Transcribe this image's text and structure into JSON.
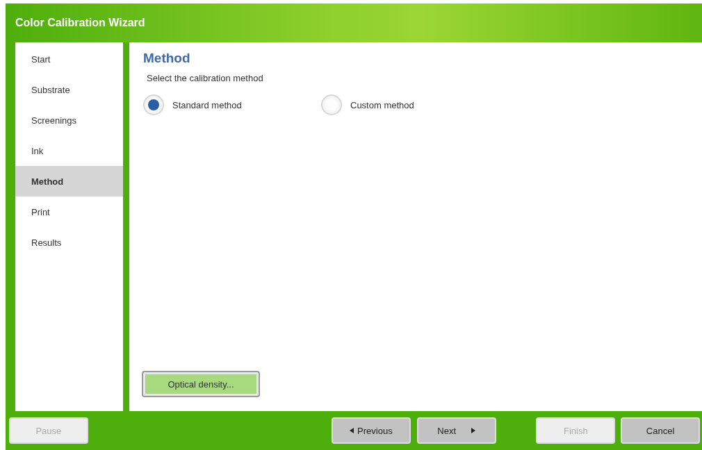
{
  "window": {
    "title": "Color Calibration Wizard"
  },
  "sidebar": {
    "items": [
      {
        "label": "Start",
        "selected": false
      },
      {
        "label": "Substrate",
        "selected": false
      },
      {
        "label": "Screenings",
        "selected": false
      },
      {
        "label": "Ink",
        "selected": false
      },
      {
        "label": "Method",
        "selected": true
      },
      {
        "label": "Print",
        "selected": false
      },
      {
        "label": "Results",
        "selected": false
      }
    ]
  },
  "content": {
    "heading": "Method",
    "instruction": "Select the calibration method",
    "options": [
      {
        "label": "Standard method",
        "selected": true
      },
      {
        "label": "Custom method",
        "selected": false
      }
    ],
    "action_button": "Optical density..."
  },
  "footer": {
    "buttons": [
      {
        "label": "Pause",
        "kind": "plain",
        "disabled": true
      },
      {
        "label": "Previous",
        "kind": "back",
        "disabled": false
      },
      {
        "label": "Next",
        "kind": "forward",
        "disabled": false
      },
      {
        "label": "Finish",
        "kind": "plain",
        "disabled": true
      },
      {
        "label": "Cancel",
        "kind": "plain",
        "disabled": false
      }
    ]
  }
}
